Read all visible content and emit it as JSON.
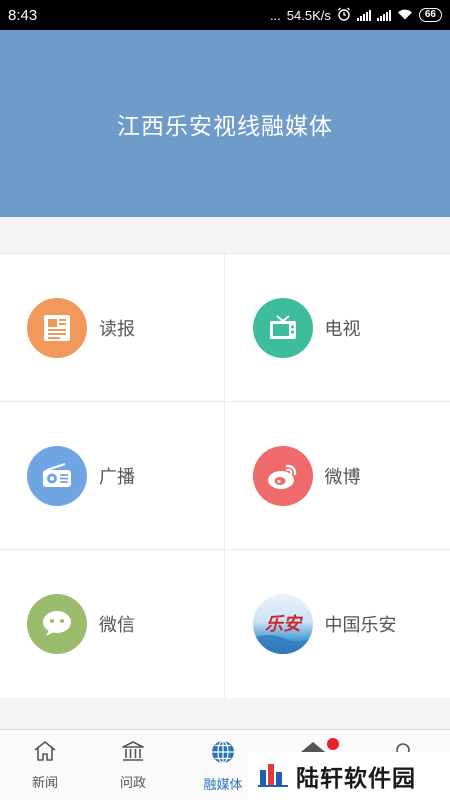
{
  "status_bar": {
    "time": "8:43",
    "dots": "...",
    "speed": "54.5K/s",
    "battery": "66"
  },
  "header": {
    "title": "江西乐安视线融媒体"
  },
  "grid": [
    {
      "label": "读报",
      "icon": "newspaper-icon",
      "color": "#f0995a"
    },
    {
      "label": "电视",
      "icon": "tv-icon",
      "color": "#3dbd9c"
    },
    {
      "label": "广播",
      "icon": "radio-icon",
      "color": "#6fa5e3"
    },
    {
      "label": "微博",
      "icon": "weibo-icon",
      "color": "#ef6b6b"
    },
    {
      "label": "微信",
      "icon": "wechat-icon",
      "color": "#9bbc6c"
    },
    {
      "label": "中国乐安",
      "icon": "lean-logo-icon",
      "logo_text": "乐安",
      "color": "#4c9fd6"
    }
  ],
  "tabs": [
    {
      "label": "新闻",
      "icon": "home-icon"
    },
    {
      "label": "问政",
      "icon": "government-icon"
    },
    {
      "label": "融媒体",
      "icon": "globe-icon",
      "active": true
    },
    {
      "label": "",
      "icon": "home-roof-icon",
      "badge": true
    },
    {
      "label": "",
      "icon": "user-icon"
    }
  ],
  "watermark": {
    "text": "陆轩软件园"
  }
}
